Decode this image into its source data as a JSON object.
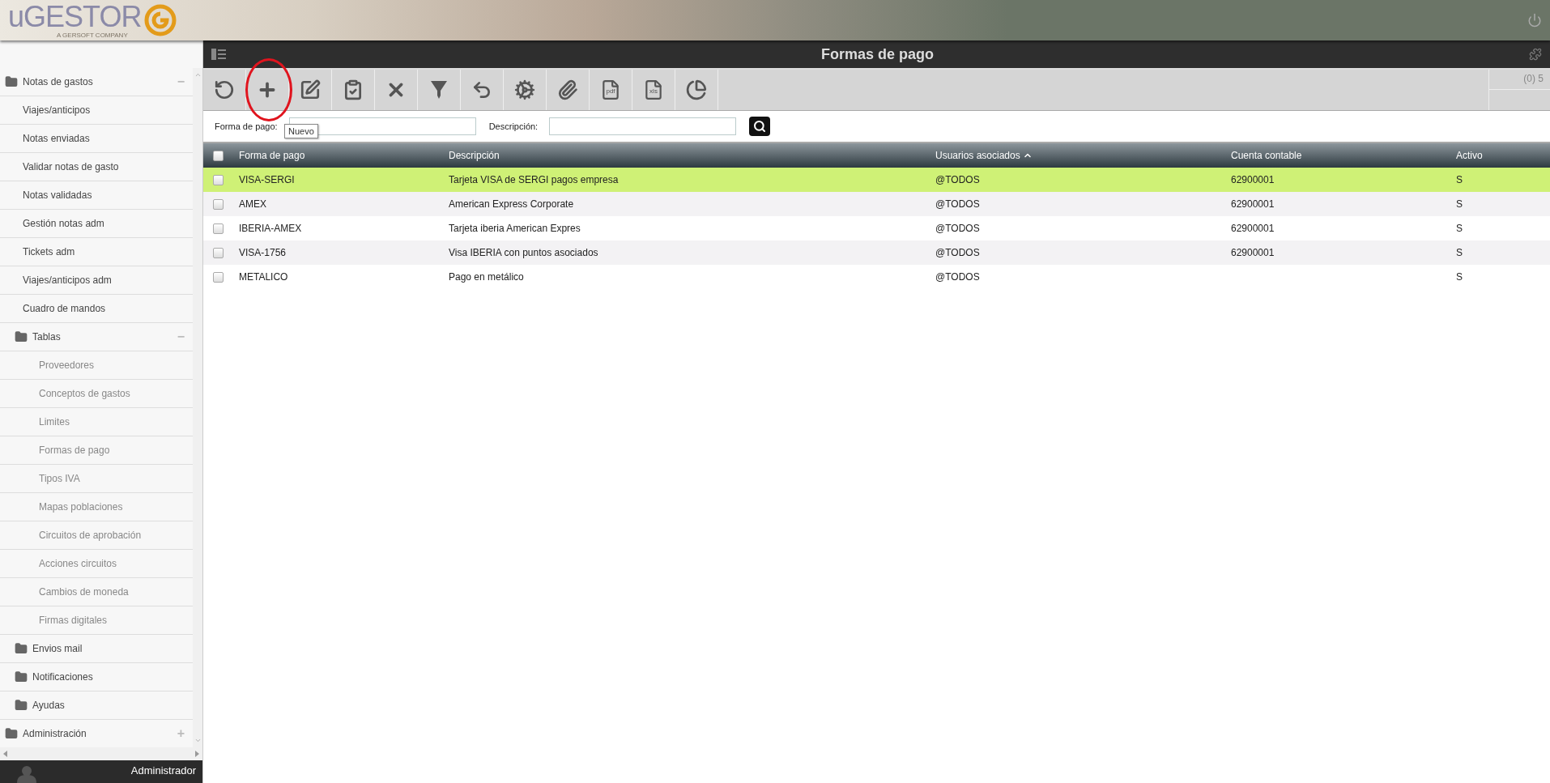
{
  "header": {
    "logo": "uGESTOR",
    "tagline": "A GERSOFT COMPANY"
  },
  "sidebar": {
    "items": [
      {
        "kind": "group",
        "label": "Notas de gastos",
        "expanded": true,
        "toggle": "−",
        "children": [
          {
            "kind": "item",
            "label": "Viajes/anticipos"
          },
          {
            "kind": "item",
            "label": "Notas enviadas"
          },
          {
            "kind": "item",
            "label": "Validar notas de gasto"
          },
          {
            "kind": "item",
            "label": "Notas validadas"
          },
          {
            "kind": "item",
            "label": "Gestión notas adm"
          },
          {
            "kind": "item",
            "label": "Tickets adm"
          },
          {
            "kind": "item",
            "label": "Viajes/anticipos adm"
          },
          {
            "kind": "item",
            "label": "Cuadro de mandos"
          },
          {
            "kind": "group",
            "label": "Tablas",
            "expanded": true,
            "toggle": "−",
            "children": [
              {
                "kind": "item",
                "label": "Proveedores"
              },
              {
                "kind": "item",
                "label": "Conceptos de gastos"
              },
              {
                "kind": "item",
                "label": "Limites"
              },
              {
                "kind": "item",
                "label": "Formas de pago"
              },
              {
                "kind": "item",
                "label": "Tipos IVA"
              },
              {
                "kind": "item",
                "label": "Mapas poblaciones"
              },
              {
                "kind": "item",
                "label": "Circuitos de aprobación"
              },
              {
                "kind": "item",
                "label": "Acciones circuitos"
              },
              {
                "kind": "item",
                "label": "Cambios de moneda"
              },
              {
                "kind": "item",
                "label": "Firmas digitales"
              }
            ]
          },
          {
            "kind": "folder",
            "label": "Envios mail"
          },
          {
            "kind": "folder",
            "label": "Notificaciones"
          },
          {
            "kind": "folder",
            "label": "Ayudas"
          }
        ]
      },
      {
        "kind": "group",
        "label": "Administración",
        "expanded": false,
        "toggle": "+"
      }
    ]
  },
  "user": {
    "name": "Administrador"
  },
  "page": {
    "title": "Formas de pago"
  },
  "toolbar": {
    "buttons": [
      {
        "kind": "refresh"
      },
      {
        "kind": "new",
        "highlighted": true,
        "tooltip": "Nuevo"
      },
      {
        "kind": "edit"
      },
      {
        "kind": "checklist"
      },
      {
        "kind": "delete"
      },
      {
        "kind": "filter"
      },
      {
        "kind": "undo"
      },
      {
        "kind": "settings"
      },
      {
        "kind": "attach"
      },
      {
        "kind": "file",
        "label": "pdf"
      },
      {
        "kind": "file",
        "label": "xls"
      },
      {
        "kind": "pie"
      }
    ],
    "counter": "(0) 5"
  },
  "filters": [
    {
      "label": "Forma de pago:"
    },
    {
      "label": "Descripción:"
    }
  ],
  "table": {
    "select_all_checked": false,
    "columns": [
      {
        "label": "Forma de pago"
      },
      {
        "label": "Descripción"
      },
      {
        "label": "Usuarios asociados",
        "sorted": true
      },
      {
        "label": "Cuenta contable"
      },
      {
        "label": "Activo"
      }
    ],
    "rows": [
      {
        "selected": true,
        "checked": false,
        "cells": [
          "VISA-SERGI",
          "Tarjeta VISA de SERGI pagos empresa",
          "@TODOS",
          "62900001",
          "S"
        ]
      },
      {
        "selected": false,
        "checked": false,
        "cells": [
          "AMEX",
          "American Express Corporate",
          "@TODOS",
          "62900001",
          "S"
        ]
      },
      {
        "selected": false,
        "checked": false,
        "cells": [
          "IBERIA-AMEX",
          "Tarjeta iberia American Expres",
          "@TODOS",
          "62900001",
          "S"
        ]
      },
      {
        "selected": false,
        "checked": false,
        "cells": [
          "VISA-1756",
          "Visa IBERIA con puntos asociados",
          "@TODOS",
          "62900001",
          "S"
        ]
      },
      {
        "selected": false,
        "checked": false,
        "cells": [
          "METALICO",
          "Pago en metálico",
          "@TODOS",
          "",
          "S"
        ]
      }
    ]
  }
}
